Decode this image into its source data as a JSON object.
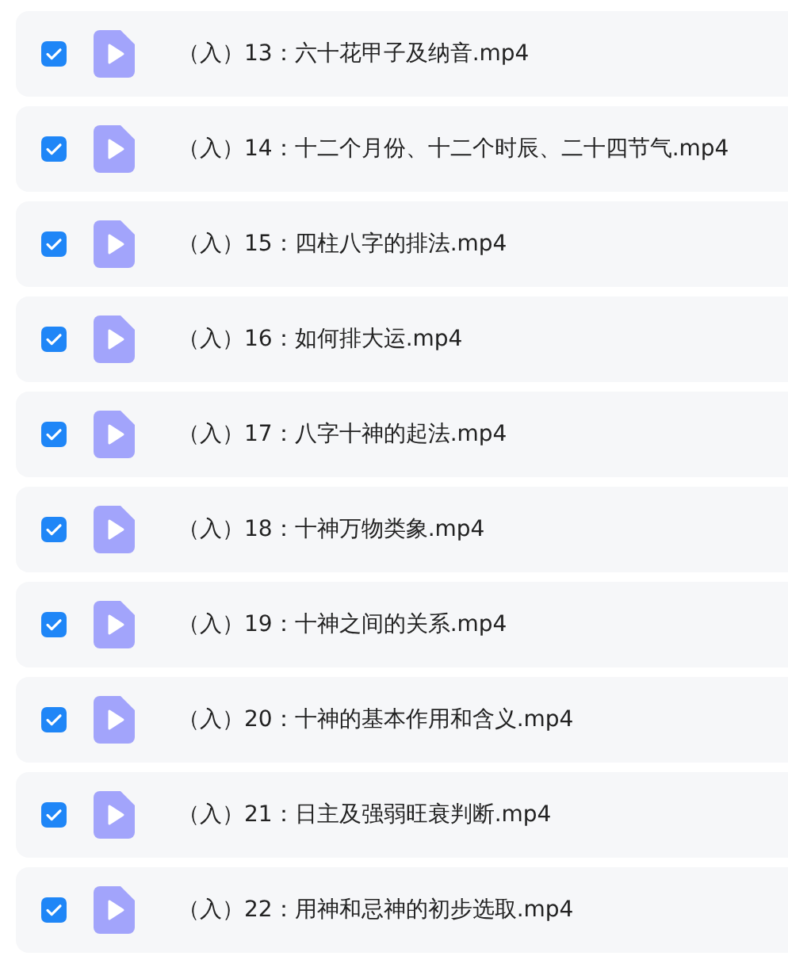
{
  "files": [
    {
      "name": "（入）13：六十花甲子及纳音.mp4",
      "checked": true
    },
    {
      "name": "（入）14：十二个月份、十二个时辰、二十四节气.mp4",
      "checked": true
    },
    {
      "name": "（入）15：四柱八字的排法.mp4",
      "checked": true
    },
    {
      "name": "（入）16：如何排大运.mp4",
      "checked": true
    },
    {
      "name": "（入）17：八字十神的起法.mp4",
      "checked": true
    },
    {
      "name": "（入）18：十神万物类象.mp4",
      "checked": true
    },
    {
      "name": "（入）19：十神之间的关系.mp4",
      "checked": true
    },
    {
      "name": "（入）20：十神的基本作用和含义.mp4",
      "checked": true
    },
    {
      "name": "（入）21：日主及强弱旺衰判断.mp4",
      "checked": true
    },
    {
      "name": "（入）22：用神和忌神的初步选取.mp4",
      "checked": true
    }
  ]
}
